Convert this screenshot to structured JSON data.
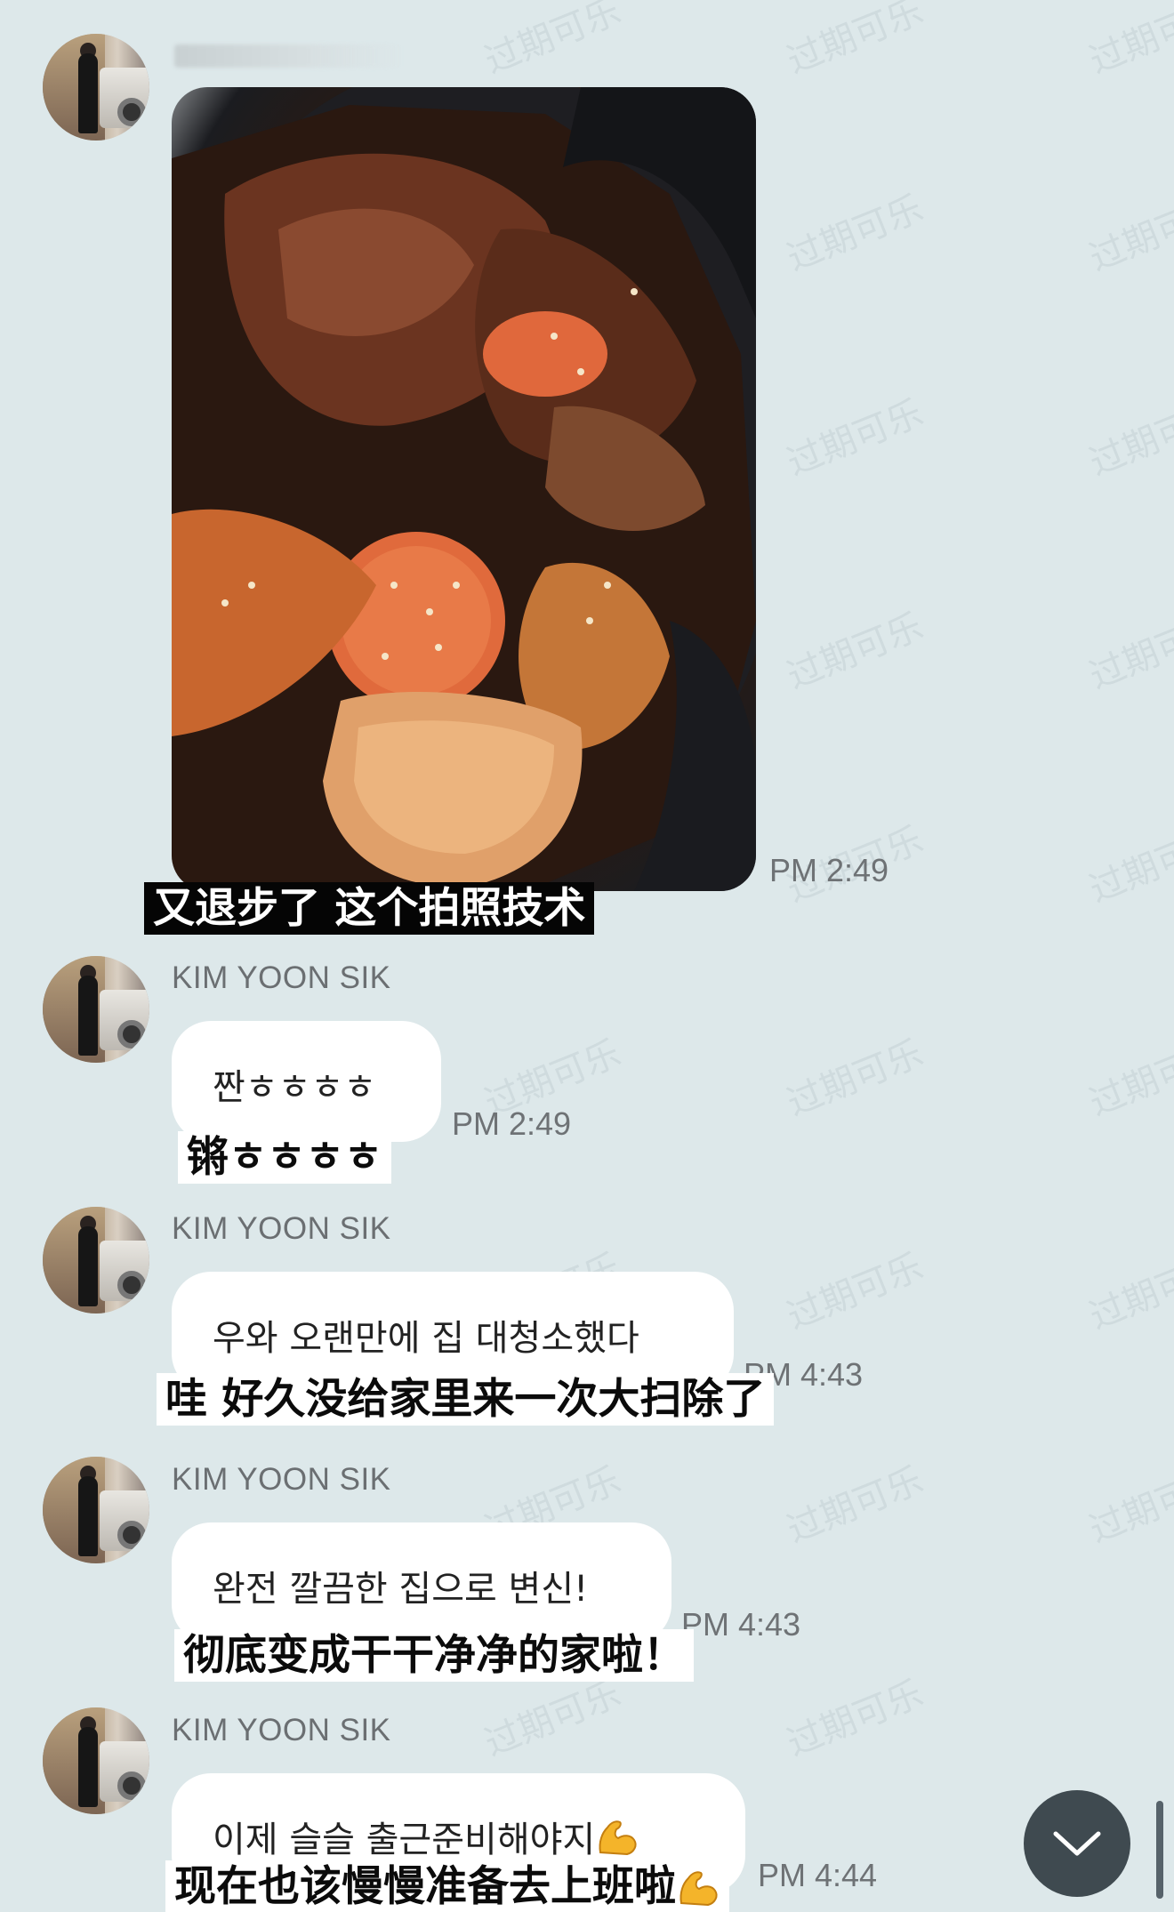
{
  "watermark_text": "过期可乐",
  "messages": [
    {
      "sender": "",
      "time": "PM 2:49",
      "subtitle": "又退步了 这个拍照技术"
    },
    {
      "sender": "KIM YOON SIK",
      "text": "짠ㅎㅎㅎㅎ",
      "time": "PM 2:49",
      "subtitle": "锵ㅎㅎㅎㅎ"
    },
    {
      "sender": "KIM YOON SIK",
      "text": "우와 오랜만에 집 대청소했다",
      "time": "PM 4:43",
      "subtitle": "哇 好久没给家里来一次大扫除了"
    },
    {
      "sender": "KIM YOON SIK",
      "text": "완전 깔끔한 집으로 변신!",
      "time": "PM 4:43",
      "subtitle": "彻底变成干干净净的家啦！"
    },
    {
      "sender": "KIM YOON SIK",
      "text": "이제 슬슬 출근준비해야지",
      "time": "PM 4:44",
      "subtitle": "现在也该慢慢准备去上班啦"
    }
  ],
  "colors": {
    "background": "#dde8ea",
    "bubble": "#ffffff",
    "scroll_button": "#3f4a50"
  },
  "icons": {
    "scroll_down": "chevron-down-icon",
    "flexed_biceps": "flexed-biceps-icon"
  }
}
